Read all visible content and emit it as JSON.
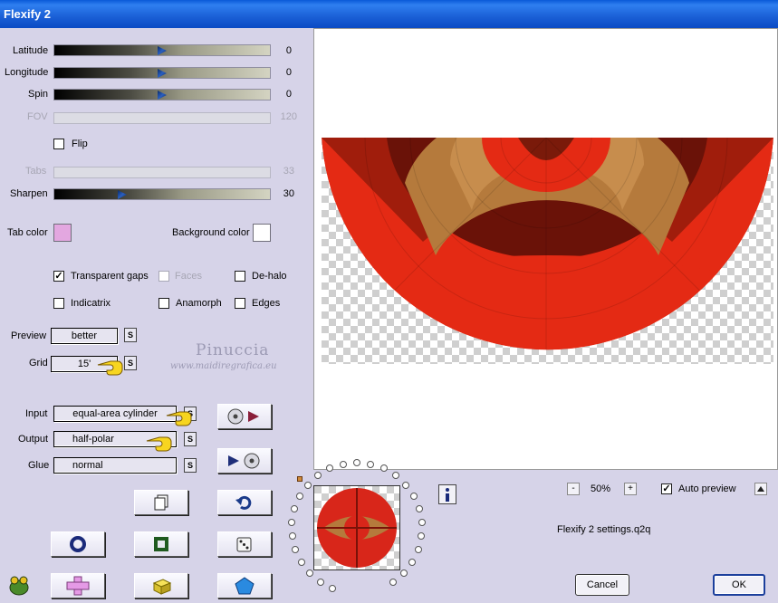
{
  "window": {
    "title": "Flexify 2"
  },
  "sliders": {
    "latitude": {
      "label": "Latitude",
      "value": "0"
    },
    "longitude": {
      "label": "Longitude",
      "value": "0"
    },
    "spin": {
      "label": "Spin",
      "value": "0"
    },
    "fov": {
      "label": "FOV",
      "value": "120"
    },
    "tabs": {
      "label": "Tabs",
      "value": "33"
    },
    "sharpen": {
      "label": "Sharpen",
      "value": "30"
    }
  },
  "flip": {
    "label": "Flip"
  },
  "colors": {
    "tab_label": "Tab color",
    "tab_value": "#e3a7e0",
    "bg_label": "Background color",
    "bg_value": "#ffffff"
  },
  "options": {
    "transparent_gaps": "Transparent gaps",
    "faces": "Faces",
    "de_halo": "De-halo",
    "indicatrix": "Indicatrix",
    "anamorph": "Anamorph",
    "edges": "Edges"
  },
  "dropdowns": {
    "preview": {
      "label": "Preview",
      "value": "better"
    },
    "grid": {
      "label": "Grid",
      "value": "15'"
    },
    "input": {
      "label": "Input",
      "value": "equal-area cylinder"
    },
    "output": {
      "label": "Output",
      "value": "half-polar"
    },
    "glue": {
      "label": "Glue",
      "value": "normal"
    }
  },
  "small_button": "S",
  "watermark": {
    "name": "Pinuccia",
    "url": "www.maidiregrafica.eu"
  },
  "zoom": {
    "minus": "-",
    "value": "50%",
    "plus": "+"
  },
  "auto_preview": {
    "label": "Auto preview"
  },
  "settings_file": "Flexify 2 settings.q2q",
  "buttons": {
    "cancel": "Cancel",
    "ok": "OK"
  },
  "icons": {
    "info": "info-icon",
    "check": "✓"
  }
}
